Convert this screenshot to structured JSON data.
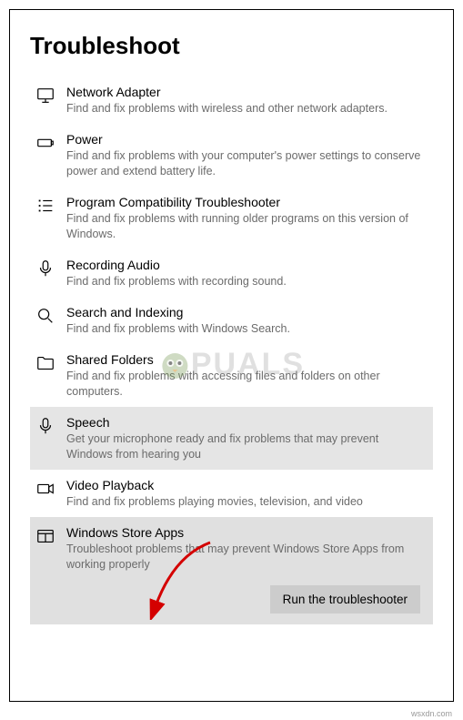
{
  "page_title": "Troubleshoot",
  "items": [
    {
      "icon": "monitor",
      "title": "Network Adapter",
      "desc": "Find and fix problems with wireless and other network adapters."
    },
    {
      "icon": "battery",
      "title": "Power",
      "desc": "Find and fix problems with your computer's power settings to conserve power and extend battery life."
    },
    {
      "icon": "list",
      "title": "Program Compatibility Troubleshooter",
      "desc": "Find and fix problems with running older programs on this version of Windows."
    },
    {
      "icon": "mic",
      "title": "Recording Audio",
      "desc": "Find and fix problems with recording sound."
    },
    {
      "icon": "search",
      "title": "Search and Indexing",
      "desc": "Find and fix problems with Windows Search."
    },
    {
      "icon": "folder",
      "title": "Shared Folders",
      "desc": "Find and fix problems with accessing files and folders on other computers."
    },
    {
      "icon": "mic",
      "title": "Speech",
      "desc": "Get your microphone ready and fix problems that may prevent Windows from hearing you",
      "selected": true
    },
    {
      "icon": "video",
      "title": "Video Playback",
      "desc": "Find and fix problems playing movies, television, and video"
    },
    {
      "icon": "store",
      "title": "Windows Store Apps",
      "desc": "Troubleshoot problems that may prevent Windows Store Apps from working properly",
      "expanded": true
    }
  ],
  "run_button_label": "Run the troubleshooter",
  "watermark_text": "PUALS",
  "footer_text": "wsxdn.com"
}
